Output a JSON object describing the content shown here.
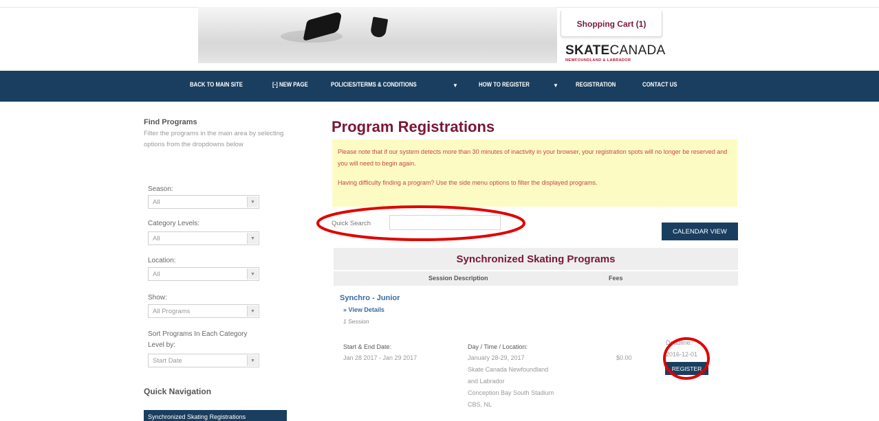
{
  "header": {
    "cart_label": "Shopping Cart (1)",
    "brand_bold": "SKATE",
    "brand_light": "CANADA",
    "brand_sub": "NEWFOUNDLAND & LABRADOR"
  },
  "nav": {
    "items": [
      {
        "label": "BACK TO MAIN SITE"
      },
      {
        "label": "[-] NEW PAGE"
      },
      {
        "label": "POLICIES/TERMS & CONDITIONS"
      },
      {
        "label": "HOW TO REGISTER"
      },
      {
        "label": "REGISTRATION"
      },
      {
        "label": "CONTACT US"
      }
    ],
    "arrow": "▼"
  },
  "sidebar": {
    "find_title": "Find Programs",
    "find_desc": "Filter the programs in the main area by selecting options from the dropdowns below",
    "filters": [
      {
        "label": "Season:",
        "value": "All"
      },
      {
        "label": "Category Levels:",
        "value": "All"
      },
      {
        "label": "Location:",
        "value": "All"
      },
      {
        "label": "Show:",
        "value": "All Programs"
      }
    ],
    "sort_label": "Sort Programs In Each Category Level by:",
    "sort_value": "Start Date",
    "quick_nav_title": "Quick Navigation",
    "quick_nav_item": "Synchronized Skating Registrations"
  },
  "main": {
    "title": "Program Registrations",
    "notice_1": "Please note that if our system detects more than 30 minutes of inactivity in your browser, your registration spots will no longer be reserved and you will need to begin again.",
    "notice_2": "Having difficulty finding a program? Use the side menu options to filter the displayed programs.",
    "quick_search_label": "Quick Search",
    "calendar_view": "CALENDAR VIEW",
    "section_title": "Synchronized Skating Programs",
    "col_session": "Session Description",
    "col_fees": "Fees",
    "program_name": "Synchro - Junior",
    "view_details": "» View Details",
    "sessions_count": "1 Session",
    "start_end_label": "Start & End Date:",
    "start_end_value": "Jan 28 2017 - Jan 29 2017",
    "dtl_label": "Day / Time / Location:",
    "dtl_lines": [
      "January 28-29, 2017",
      "Skate Canada Newfoundland",
      "and Labrador",
      "Conception Bay South Stadium",
      "CBS, NL"
    ],
    "fee": "$0.00",
    "reg_deadline_label": "Deadline:",
    "reg_deadline": "2016-12-01",
    "register": "REGISTER"
  },
  "annotation_color": "#e00000"
}
